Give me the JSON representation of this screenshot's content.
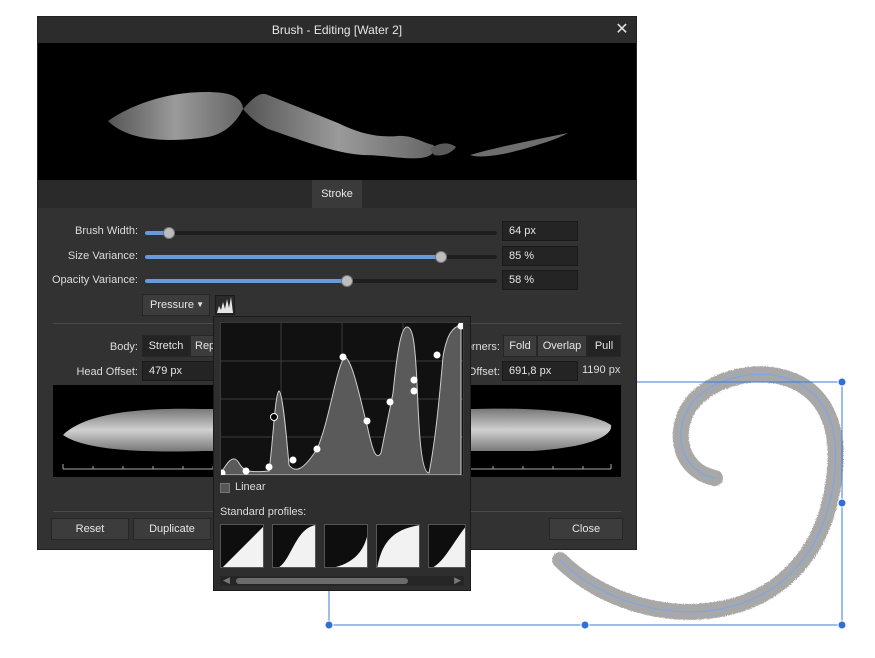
{
  "window": {
    "title": "Brush - Editing [Water 2]",
    "close_glyph": "✕"
  },
  "tabs": [
    {
      "label": "Stroke"
    }
  ],
  "controls": {
    "brush_width": {
      "label": "Brush Width:",
      "value": "64 px",
      "fraction": 0.03
    },
    "size_variance": {
      "label": "Size Variance:",
      "value": "85 %",
      "fraction": 0.85
    },
    "opacity_variance": {
      "label": "Opacity Variance:",
      "value": "58 %",
      "fraction": 0.58
    },
    "controller": {
      "label": "Pressure",
      "arrow_icon": "triangle-down-icon",
      "curve_icon": "pressure-curve-icon"
    }
  },
  "body": {
    "label": "Body:",
    "modes": [
      "Stretch",
      "Rep"
    ],
    "selected": "Stretch"
  },
  "corners": {
    "label": "orners:",
    "modes": [
      "Fold",
      "Overlap",
      "Pull"
    ],
    "selected": "Pull"
  },
  "head_offset": {
    "label": "Head Offset:",
    "value": "479 px"
  },
  "tail_offset": {
    "label": "Offset:",
    "value": "691,8 px",
    "total": "1190 px"
  },
  "footer": {
    "reset": "Reset",
    "duplicate": "Duplicate",
    "close": "Close"
  },
  "popup": {
    "linear_label": "Linear",
    "linear_checked": false,
    "standard_profiles_label": "Standard profiles:",
    "profiles": [
      "linear-profile",
      "ease-in-out-profile",
      "convex-profile",
      "concave-profile",
      "partial-profile"
    ],
    "scroll_left_icon": "◀",
    "scroll_right_icon": "▶"
  },
  "colors": {
    "accent": "#6a9ad8",
    "selection": "#3a7ad8",
    "panel": "#323232"
  }
}
